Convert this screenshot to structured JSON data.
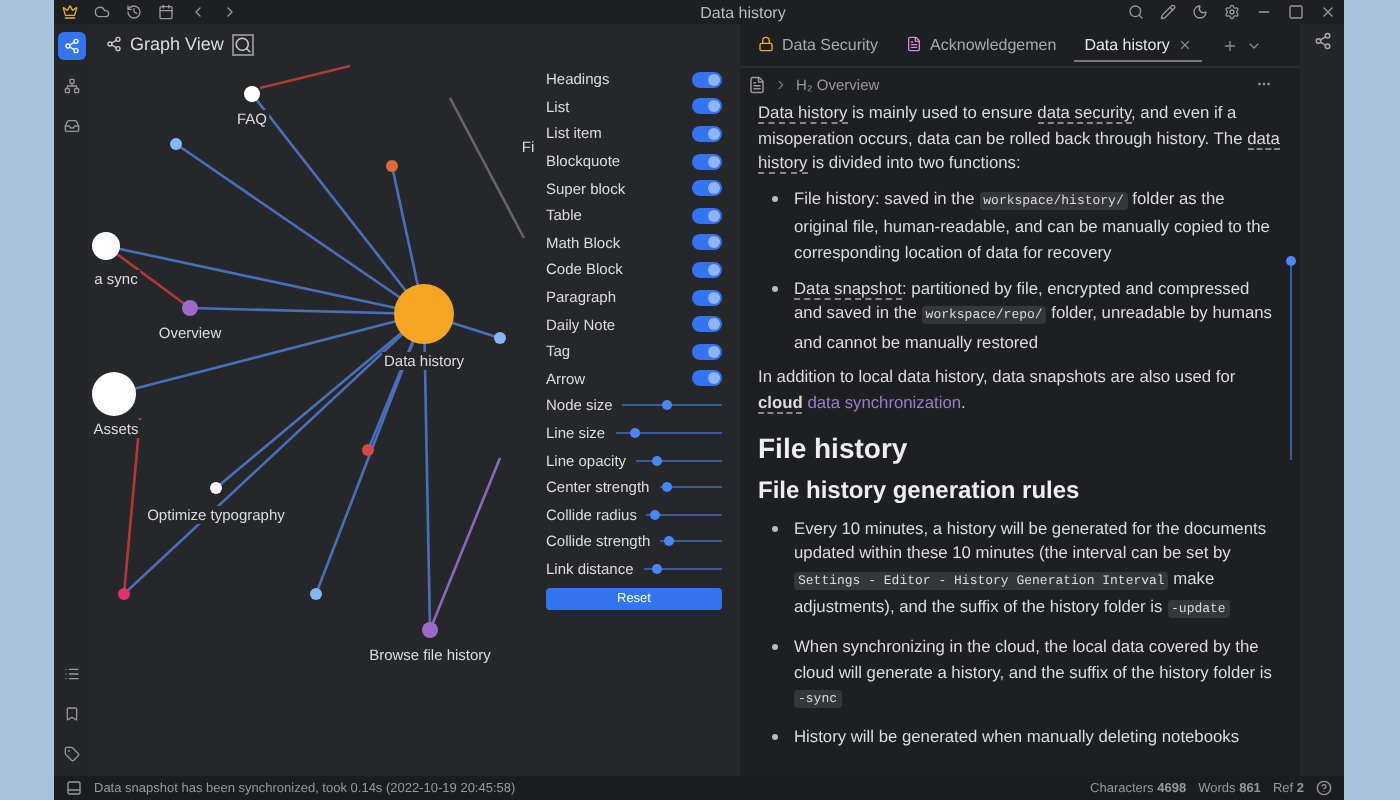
{
  "titlebar": {
    "title": "Data history"
  },
  "graph": {
    "title": "Graph View",
    "labels": [
      "FAQ",
      "a sync",
      "Overview",
      "Assets",
      "Data history",
      "Optimize typography",
      "Browse file history",
      "Fi"
    ],
    "toggles": [
      {
        "label": "Headings",
        "on": true
      },
      {
        "label": "List",
        "on": true
      },
      {
        "label": "List item",
        "on": true
      },
      {
        "label": "Blockquote",
        "on": true
      },
      {
        "label": "Super block",
        "on": true
      },
      {
        "label": "Table",
        "on": true
      },
      {
        "label": "Math Block",
        "on": true
      },
      {
        "label": "Code Block",
        "on": true
      },
      {
        "label": "Paragraph",
        "on": true
      },
      {
        "label": "Daily Note",
        "on": true
      },
      {
        "label": "Tag",
        "on": true
      },
      {
        "label": "Arrow",
        "on": true
      }
    ],
    "sliders": [
      {
        "label": "Node size",
        "level": 0.45
      },
      {
        "label": "Line size",
        "level": 0.15
      },
      {
        "label": "Line opacity",
        "level": 0.2
      },
      {
        "label": "Center strength",
        "level": 0.05
      },
      {
        "label": "Collide radius",
        "level": 0.05
      },
      {
        "label": "Collide strength",
        "level": 0.08
      },
      {
        "label": "Link distance",
        "level": 0.12
      }
    ],
    "reset": "Reset"
  },
  "tabs": [
    {
      "label": "Data Security",
      "selected": false,
      "kind": "lock"
    },
    {
      "label": "Acknowledgemen",
      "selected": false,
      "kind": "doc"
    },
    {
      "label": "Data history",
      "selected": true,
      "kind": "none"
    }
  ],
  "breadcrumb": {
    "level": "H₂",
    "label": "Overview"
  },
  "content": [
    {
      "kind": "p",
      "parts": [
        {
          "kind": "ref",
          "s": "Data history"
        },
        {
          "kind": "plain",
          "s": " is mainly used to ensure "
        },
        {
          "kind": "ref",
          "s": "data security"
        },
        {
          "kind": "plain",
          "s": ", and even if a misoperation occurs, data can be rolled back through history. The "
        },
        {
          "kind": "ref",
          "s": "data history"
        },
        {
          "kind": "plain",
          "s": " is divided into two functions:"
        }
      ]
    },
    {
      "kind": "li",
      "parts": [
        {
          "kind": "plain",
          "s": "File history: saved in the "
        },
        {
          "kind": "code",
          "s": "workspace/history/"
        },
        {
          "kind": "plain",
          "s": " folder as the original file, human-readable, and can be manually copied to the corresponding location of data for recovery"
        }
      ]
    },
    {
      "kind": "li",
      "parts": [
        {
          "kind": "ref",
          "s": "Data snapshot"
        },
        {
          "kind": "plain",
          "s": ": partitioned by file, encrypted and compressed and saved in the "
        },
        {
          "kind": "code",
          "s": "workspace/repo/"
        },
        {
          "kind": "plain",
          "s": " folder, unreadable by humans and cannot be manually restored"
        }
      ]
    },
    {
      "kind": "p",
      "parts": [
        {
          "kind": "plain",
          "s": "In addition to local data history, data snapshots are also used for "
        },
        {
          "kind": "refbold",
          "s": "cloud"
        },
        {
          "kind": "link",
          "s": "data synchronization"
        },
        {
          "kind": "plain",
          "s": "."
        }
      ]
    },
    {
      "kind": "h2",
      "parts": [
        {
          "kind": "plain",
          "s": "File history"
        }
      ]
    },
    {
      "kind": "h3",
      "parts": [
        {
          "kind": "plain",
          "s": "File history generation rules"
        }
      ]
    },
    {
      "kind": "li",
      "parts": [
        {
          "kind": "plain",
          "s": "Every 10 minutes, a history will be generated for the documents updated within these 10 minutes (the interval can be set by "
        },
        {
          "kind": "code",
          "s": "Settings - Editor - History Generation Interval"
        },
        {
          "kind": "plain",
          "s": " make adjustments), and the suffix of the history folder is "
        },
        {
          "kind": "code",
          "s": "-update"
        }
      ]
    },
    {
      "kind": "li",
      "parts": [
        {
          "kind": "plain",
          "s": "When synchronizing in the cloud, the local data covered by the cloud will generate a history, and the suffix of the history folder is "
        },
        {
          "kind": "code",
          "s": "-sync"
        }
      ]
    },
    {
      "kind": "li",
      "parts": [
        {
          "kind": "plain",
          "s": "History will be generated when manually deleting notebooks"
        }
      ]
    }
  ],
  "status": {
    "message": "Data snapshot has been synchronized, took 0.14s (2022-10-19 20:45:58)",
    "counts": [
      {
        "label": "Characters",
        "value": "4698"
      },
      {
        "label": "Words",
        "value": "861"
      },
      {
        "label": "Ref",
        "value": "2"
      }
    ]
  }
}
